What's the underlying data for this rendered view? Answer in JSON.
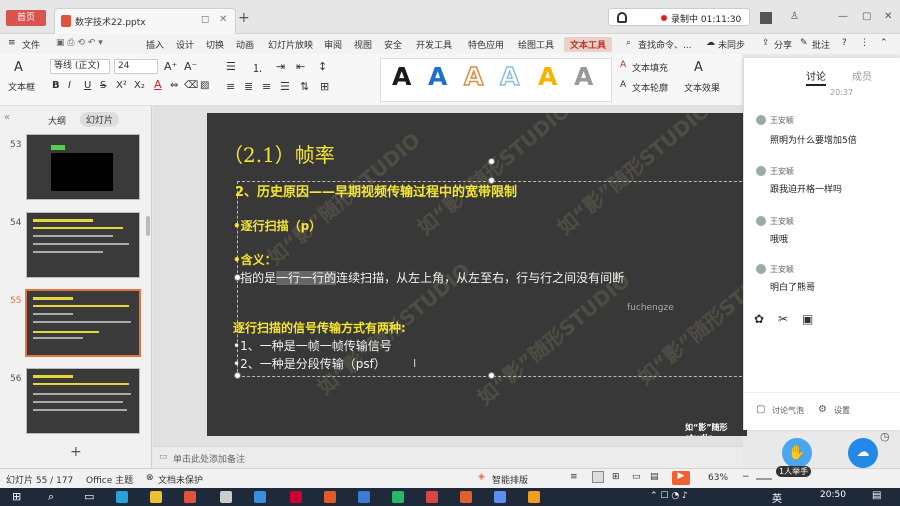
{
  "titlebar": {
    "home_tab": "首页",
    "doc_tab": "数字技术22.pptx",
    "new_tab": "+",
    "recording": "录制中 01:11:30",
    "window_controls": [
      "—",
      "▢",
      "✕"
    ]
  },
  "menubar": {
    "file": "文件",
    "items": [
      "插入",
      "设计",
      "切换",
      "动画",
      "幻灯片放映",
      "审阅",
      "视图",
      "安全",
      "开发工具",
      "特色应用",
      "绘图工具",
      "文本工具"
    ],
    "active": "文本工具",
    "search": "查找命令、...",
    "unsynced": "未同步",
    "share": "分享",
    "comment": "批注"
  },
  "toolbar": {
    "textbox": "文本框",
    "font_name": "等线 (正文)",
    "font_size": "24",
    "text_fill": "文本填充",
    "text_outline": "文本轮廓",
    "text_effect": "文本效果",
    "wordart_colors": [
      "#1a1a1a",
      "#1f6fd1",
      "#e2893d",
      "#9ecbe8",
      "#f4b400",
      "#888888"
    ]
  },
  "leftpane": {
    "tab_outline": "大纲",
    "tab_slides": "幻灯片",
    "slide_numbers": [
      "53",
      "54",
      "55",
      "56"
    ],
    "selected": "55",
    "add": "+"
  },
  "slide": {
    "title": "（2.1）帧率",
    "heading": "2、历史原因——早期视频传输过程中的宽带限制",
    "bullet1": "•逐行扫描（p）",
    "meaning_label": "•含义：",
    "meaning_prefix": "•指的是",
    "meaning_highlight": "一行一行的",
    "meaning_rest": "连续扫描，从左上角，从左至右，行与行之间没有间断",
    "watermark_name": "fuchengze",
    "sub_heading": "逐行扫描的信号传输方式有两种:",
    "item1": "•1、一种是一帧一帧传输信号",
    "item2": "•2、一种是分段传输（psf）",
    "studio": "如“影”随形studio",
    "watermark": "如“影”随形STUDIO"
  },
  "notes": {
    "placeholder": "单击此处添加备注"
  },
  "statusbar": {
    "slide_count": "幻灯片 55 / 177",
    "theme": "Office 主题",
    "doc_protect": "文档未保护",
    "smart_layout": "智能排版",
    "zoom": "63%"
  },
  "rightpanel": {
    "tab_discuss": "讨论",
    "tab_members": "成员",
    "time": "20:37",
    "comments": [
      {
        "name": "王安颖",
        "text": "照明为什么要增加5倍"
      },
      {
        "name": "王安颖",
        "text": "跟我迫开格一样吗"
      },
      {
        "name": "王安颖",
        "text": "哦哦"
      },
      {
        "name": "王安颖",
        "text": "明白了熊哥"
      }
    ],
    "bubble_label": "讨论气泡",
    "settings": "设置",
    "raise_hand": "1人举手"
  },
  "taskbar": {
    "lang": "英",
    "time": "20:50"
  }
}
